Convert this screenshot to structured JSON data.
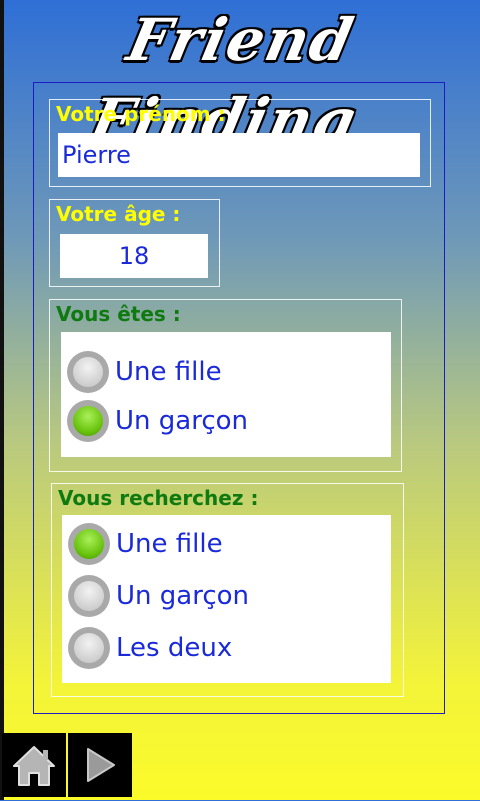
{
  "app": {
    "title": "Friend Finding"
  },
  "firstname": {
    "label": "Votre prénom :",
    "value": "Pierre"
  },
  "age": {
    "label": "Votre âge :",
    "value": "18"
  },
  "you_are": {
    "label": "Vous êtes :",
    "options": [
      {
        "label": "Une fille",
        "selected": false
      },
      {
        "label": "Un garçon",
        "selected": true
      }
    ]
  },
  "looking_for": {
    "label": "Vous recherchez :",
    "options": [
      {
        "label": "Une fille",
        "selected": true
      },
      {
        "label": "Un garçon",
        "selected": false
      },
      {
        "label": "Les deux",
        "selected": false
      }
    ]
  },
  "nav": {
    "home_icon": "home-icon",
    "next_icon": "play-arrow-icon"
  }
}
